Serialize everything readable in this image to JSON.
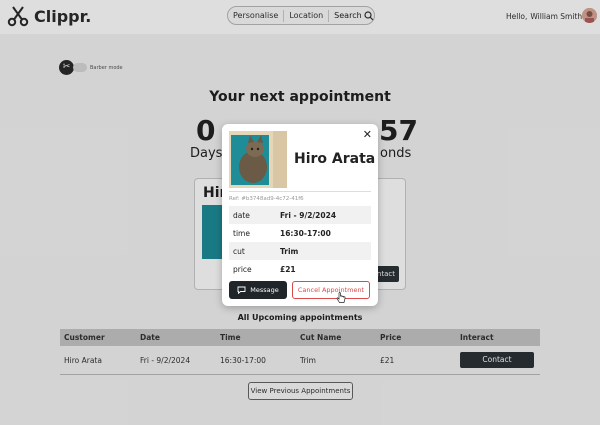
{
  "header": {
    "logo_text": "Clippr.",
    "nav": [
      "Personalise",
      "Location",
      "Search"
    ],
    "greeting": "Hello,",
    "user_name": "William Smith"
  },
  "toggle": {
    "label": "Barber mode"
  },
  "next": {
    "title": "Your next appointment",
    "days_value": "0",
    "days_label": "Days",
    "seconds_value": "57",
    "seconds_label": "onds",
    "card_name": "Hir",
    "card_button": "ntact"
  },
  "modal": {
    "name": "Hiro Arata",
    "ref": "Ref: #b3748ad9-4c72-41f6",
    "details": [
      {
        "key": "date",
        "value": "Fri - 9/2/2024"
      },
      {
        "key": "time",
        "value": "16:30-17:00"
      },
      {
        "key": "cut",
        "value": "Trim"
      },
      {
        "key": "price",
        "value": "£21"
      }
    ],
    "message_label": "Message",
    "cancel_label": "Cancel Appointment",
    "close_label": "✕"
  },
  "upcoming": {
    "title": "All Upcoming appointments",
    "headers": [
      "Customer",
      "Date",
      "Time",
      "Cut Name",
      "Price",
      "Interact"
    ],
    "rows": [
      {
        "customer": "Hiro Arata",
        "date": "Fri - 9/2/2024",
        "time": "16:30-17:00",
        "cut": "Trim",
        "price": "£21",
        "action": "Contact"
      }
    ],
    "view_previous": "View Previous Appointments"
  },
  "colors": {
    "dark_button": "#2b3236",
    "cancel_red": "#d94a4a",
    "teal": "#1e8d98"
  }
}
